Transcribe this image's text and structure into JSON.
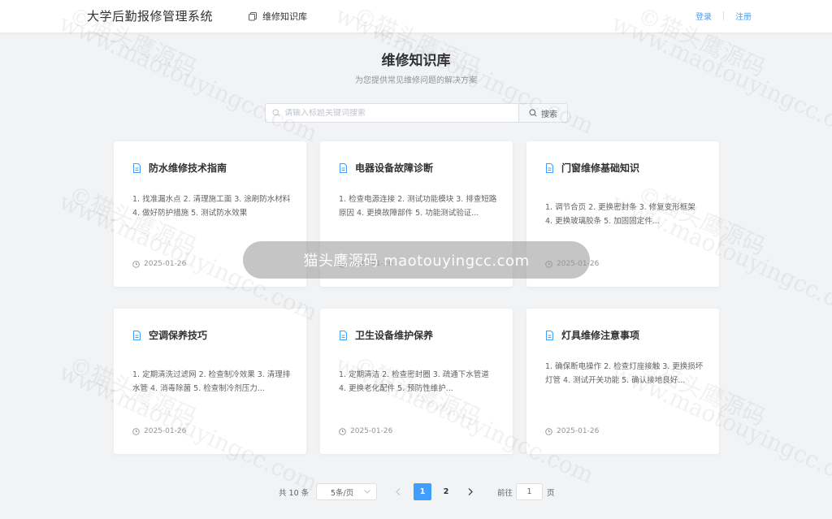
{
  "header": {
    "brand": "大学后勤报修管理系统",
    "nav_label": "维修知识库",
    "login": "登录",
    "register": "注册"
  },
  "page": {
    "title": "维修知识库",
    "subtitle": "为您提供常见维修问题的解决方案"
  },
  "search": {
    "placeholder": "请输入标题关键词搜索",
    "value": "",
    "button_label": "搜索"
  },
  "articles": [
    {
      "title": "防水维修技术指南",
      "desc": "1. 找准漏水点 2. 清理施工面 3. 涂刷防水材料 4. 做好防护措施 5. 测试防水效果",
      "date": "2025-01-26"
    },
    {
      "title": "电器设备故障诊断",
      "desc": "1. 检查电源连接 2. 测试功能模块 3. 排查短路原因 4. 更换故障部件 5. 功能测试验证...",
      "date": "2025-01-26"
    },
    {
      "title": "门窗维修基础知识",
      "desc": "1. 调节合页 2. 更换密封条 3. 修复变形框架 4. 更换玻璃胶条 5. 加固固定件...",
      "date": "2025-01-26"
    },
    {
      "title": "空调保养技巧",
      "desc": "1. 定期清洗过滤网 2. 检查制冷效果 3. 清理排水管 4. 消毒除菌 5. 检查制冷剂压力...",
      "date": "2025-01-26"
    },
    {
      "title": "卫生设备维护保养",
      "desc": "1. 定期清洁 2. 检查密封圈 3. 疏通下水管道 4. 更换老化配件 5. 预防性维护...",
      "date": "2025-01-26"
    },
    {
      "title": "灯具维修注意事项",
      "desc": "1. 确保断电操作 2. 检查灯座接触 3. 更换损坏灯管 4. 测试开关功能 5. 确认接地良好...",
      "date": "2025-01-26"
    }
  ],
  "pagination": {
    "total_text": "共 10 条",
    "page_size": "5条/页",
    "prev_icon": "chevron-left-icon",
    "pages": [
      "1",
      "2"
    ],
    "current_page": "1",
    "next_icon": "chevron-right-icon",
    "goto_label": "前往",
    "goto_value": "1",
    "page_unit": "页"
  },
  "watermark": {
    "text_cn": "©猫头鹰源码",
    "text_url": "www.maotouyingcc.com",
    "banner": "猫头鹰源码 maotouyingcc.com"
  },
  "colors": {
    "accent": "#409eff",
    "background": "#f2f3f5",
    "card": "#ffffff",
    "text_primary": "#303133",
    "text_secondary": "#606266",
    "text_muted": "#909399"
  }
}
